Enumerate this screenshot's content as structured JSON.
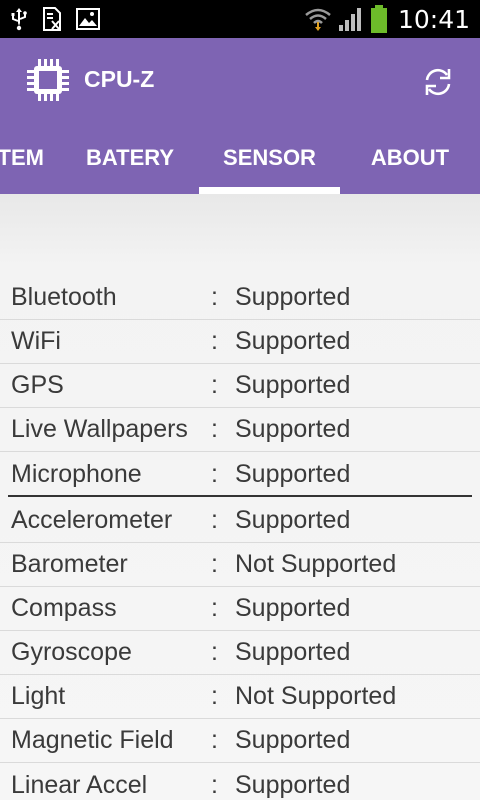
{
  "status_bar": {
    "time": "10:41",
    "left_icons": [
      "usb-icon",
      "sim-missing-icon",
      "image-icon"
    ],
    "right_icons": [
      "wifi-icon",
      "signal-icon",
      "battery-icon"
    ]
  },
  "app": {
    "title": "CPU-Z",
    "accent_color": "#7e64b3",
    "logo_icon": "chip-icon",
    "refresh_icon": "refresh-icon"
  },
  "tabs": [
    {
      "label": "TEM",
      "active": false
    },
    {
      "label": "BATERY",
      "active": false
    },
    {
      "label": "SENSOR",
      "active": true
    },
    {
      "label": "ABOUT",
      "active": false
    }
  ],
  "features": [
    {
      "label": "Bluetooth",
      "sep": ":",
      "value": "Supported"
    },
    {
      "label": "WiFi",
      "sep": ":",
      "value": "Supported"
    },
    {
      "label": "GPS",
      "sep": ":",
      "value": "Supported"
    },
    {
      "label": "Live Wallpapers",
      "sep": ":",
      "value": "Supported"
    },
    {
      "label": "Microphone",
      "sep": ":",
      "value": "Supported"
    }
  ],
  "sensors": [
    {
      "label": "Accelerometer",
      "sep": ":",
      "value": "Supported"
    },
    {
      "label": "Barometer",
      "sep": ":",
      "value": "Not Supported"
    },
    {
      "label": "Compass",
      "sep": ":",
      "value": "Supported"
    },
    {
      "label": "Gyroscope",
      "sep": ":",
      "value": "Supported"
    },
    {
      "label": "Light",
      "sep": ":",
      "value": "Not Supported"
    },
    {
      "label": "Magnetic Field",
      "sep": ":",
      "value": "Supported"
    },
    {
      "label": "Linear Accel",
      "sep": ":",
      "value": "Supported"
    }
  ]
}
